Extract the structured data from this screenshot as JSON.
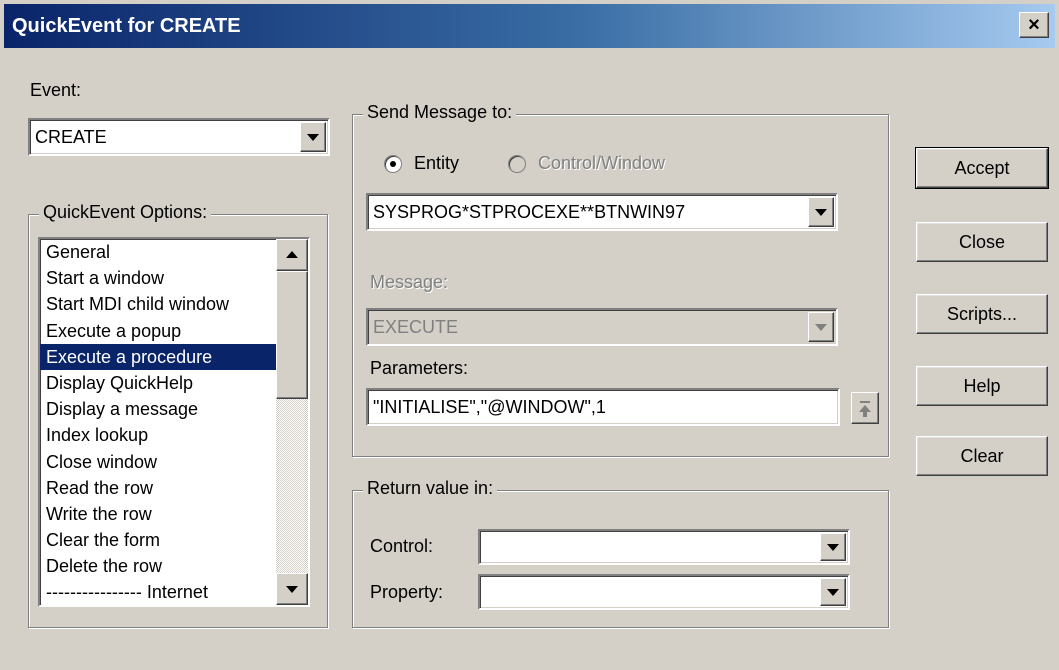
{
  "window": {
    "title": "QuickEvent for CREATE",
    "close_glyph": "×"
  },
  "event": {
    "label": "Event:",
    "value": "CREATE"
  },
  "options": {
    "label": "QuickEvent Options:",
    "items": [
      "General",
      "Start a window",
      "Start MDI child window",
      "Execute a popup",
      "Execute a procedure",
      "Display QuickHelp",
      "Display a message",
      "Index lookup",
      "Close window",
      "Read the row",
      "Write the row",
      "Clear the form",
      "Delete the row",
      "---------------- Internet"
    ],
    "selected": "Execute a procedure"
  },
  "send": {
    "label": "Send Message to:",
    "radio_entity": "Entity",
    "radio_control": "Control/Window",
    "entity_value": "SYSPROG*STPROCEXE**BTNWIN97",
    "message_label": "Message:",
    "message_value": "EXECUTE",
    "parameters_label": "Parameters:",
    "parameters_value": "\"INITIALISE\",\"@WINDOW\",1"
  },
  "return": {
    "label": "Return value in:",
    "control_label": "Control:",
    "control_value": "",
    "property_label": "Property:",
    "property_value": ""
  },
  "buttons": {
    "accept": "Accept",
    "close": "Close",
    "scripts": "Scripts...",
    "help": "Help",
    "clear": "Clear"
  },
  "colors": {
    "face": "#d4d0c8",
    "title_start": "#0a246a",
    "title_end": "#a6caf0",
    "selection": "#0a246a"
  }
}
